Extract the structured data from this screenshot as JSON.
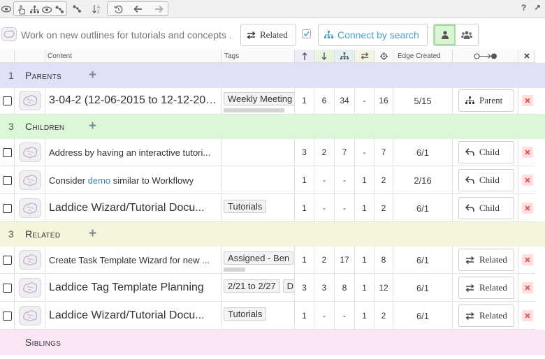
{
  "toolbar": {
    "help_label": "?",
    "expand_label": "↗"
  },
  "header": {
    "title": "Work on new outlines for tutorials and concepts ...",
    "related_label": "Related",
    "connect_label": "Connect by search"
  },
  "columns": {
    "content": "Content",
    "tags": "Tags",
    "edge_created": "Edge Created"
  },
  "sections": [
    {
      "num": "1",
      "name": "Parents"
    },
    {
      "num": "3",
      "name": "Children"
    },
    {
      "num": "3",
      "name": "Related"
    },
    {
      "num": "",
      "name": "Siblings"
    }
  ],
  "rows": [
    {
      "content": "3-04-2 (12-06-2015 to 12-12-201...",
      "tag1": "Weekly Meeting",
      "tag2": "",
      "c1": "1",
      "c2": "6",
      "c3": "34",
      "c4": "-",
      "c5": "16",
      "edge": "5/15",
      "rel": "Parent"
    },
    {
      "content": "Address by having an interactive tutori...",
      "tag1": "",
      "tag2": "",
      "c1": "3",
      "c2": "2",
      "c3": "7",
      "c4": "-",
      "c5": "7",
      "edge": "6/1",
      "rel": "Child"
    },
    {
      "content_pre": "Consider ",
      "content_link": "demo",
      "content_post": " similar to Workflowy",
      "tag1": "",
      "tag2": "",
      "c1": "1",
      "c2": "-",
      "c3": "-",
      "c4": "1",
      "c5": "2",
      "edge": "2/16",
      "rel": "Child"
    },
    {
      "content": "Laddice Wizard/Tutorial Docu...",
      "tag1": "Tutorials",
      "tag2": "",
      "c1": "1",
      "c2": "-",
      "c3": "-",
      "c4": "1",
      "c5": "2",
      "edge": "6/1",
      "rel": "Child"
    },
    {
      "content": "Create Task Template Wizard for new ...",
      "tag1": "Assigned - Ben",
      "tag2": "",
      "c1": "1",
      "c2": "2",
      "c3": "17",
      "c4": "1",
      "c5": "8",
      "edge": "6/1",
      "rel": "Related"
    },
    {
      "content": "Laddice Tag Template Planning",
      "tag1": "2/21 to 2/27",
      "tag2": "D",
      "c1": "3",
      "c2": "3",
      "c3": "8",
      "c4": "1",
      "c5": "12",
      "edge": "6/1",
      "rel": "Related"
    },
    {
      "content": "Laddice Wizard/Tutorial Docu...",
      "tag1": "Tutorials",
      "tag2": "",
      "c1": "1",
      "c2": "-",
      "c3": "-",
      "c4": "1",
      "c5": "2",
      "edge": "6/1",
      "rel": "Related"
    }
  ],
  "colors": {
    "parents_bg": "#e0e0f6",
    "children_bg": "#dcf6d8",
    "related_bg": "#f5f5dc",
    "siblings_bg": "#fae6f6",
    "accent": "#4aa0c8"
  }
}
